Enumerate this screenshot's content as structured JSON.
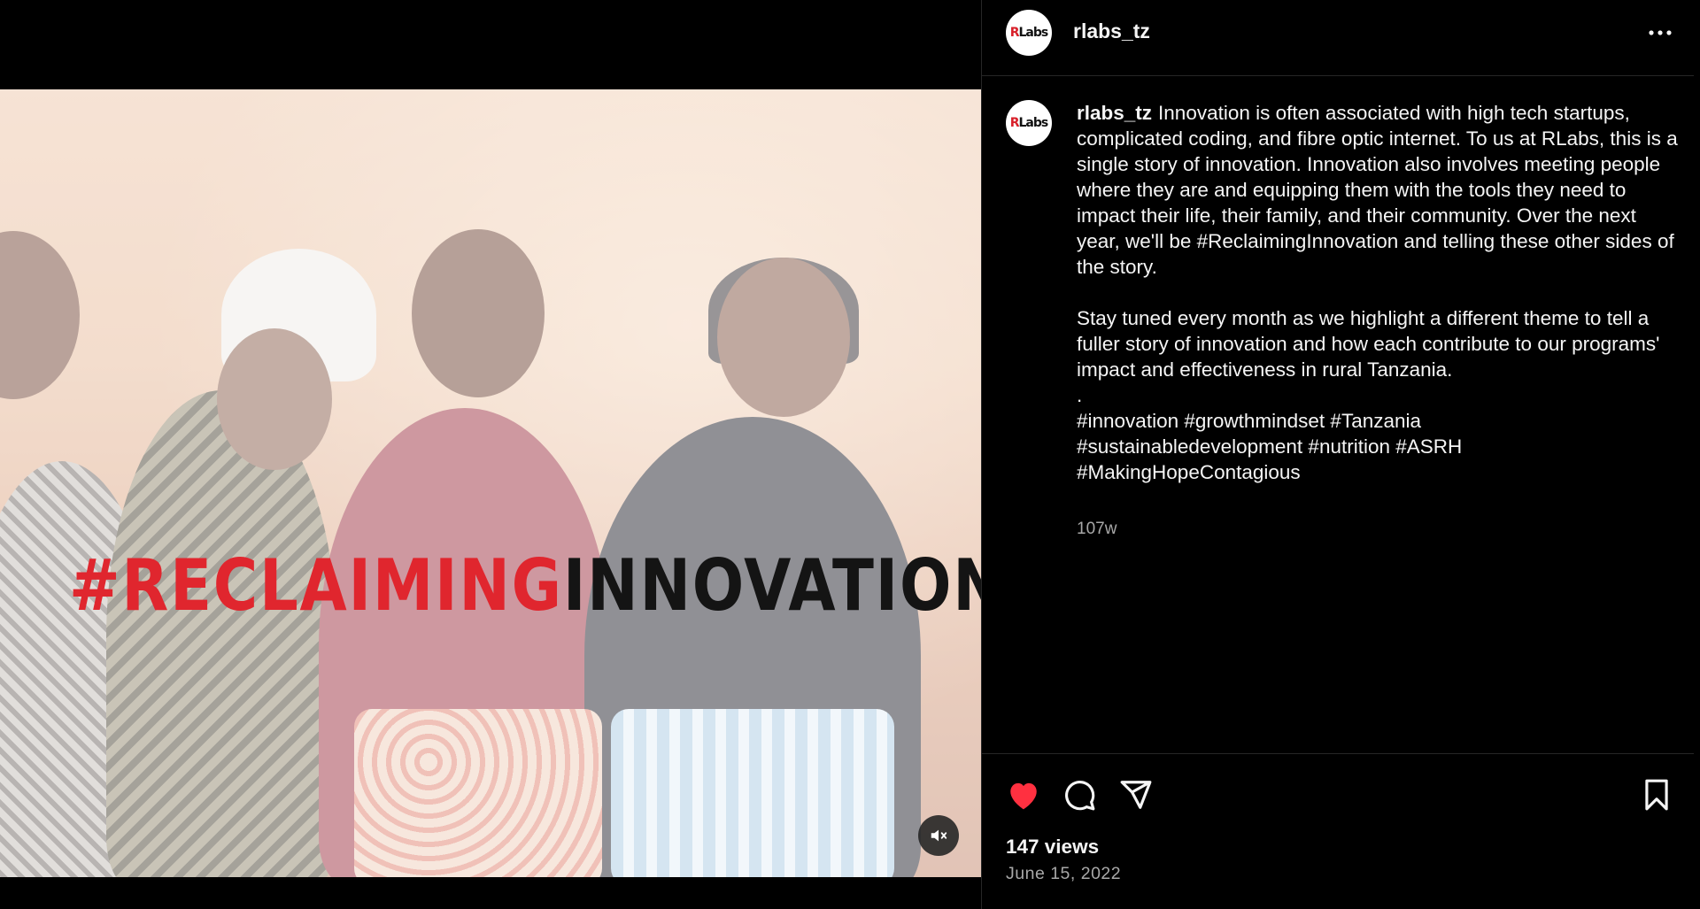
{
  "media": {
    "overlay_text_red": "#RECLAIMING",
    "overlay_text_black": "INNOVATION",
    "mute_icon": "speaker-muted-icon"
  },
  "header": {
    "username": "rlabs_tz",
    "avatar_logo_r": "R",
    "avatar_logo_rest": "Labs",
    "more_icon": "more-horizontal-icon"
  },
  "caption": {
    "username": "rlabs_tz",
    "para1": "Innovation is often associated with high tech startups, complicated coding, and fibre optic internet. To us at RLabs, this is a single story of innovation. Innovation also involves meeting people where they are and equipping them with the tools they need to impact their life, their family, and their community. Over the next year, we'll be #ReclaimingInnovation and telling these other sides of the story.",
    "para2": "Stay tuned every month as we highlight a different theme to tell a fuller story of innovation and how each contribute to our programs' impact and effectiveness in rural Tanzania.",
    "dot": ".",
    "hashtags": "#innovation #growthmindset #Tanzania\n#sustainabledevelopment #nutrition #ASRH\n#MakingHopeContagious",
    "relative_time": "107w"
  },
  "actions": {
    "like_icon": "heart-filled-icon",
    "comment_icon": "comment-icon",
    "share_icon": "paper-plane-icon",
    "save_icon": "bookmark-icon",
    "views": "147 views",
    "date": "June 15, 2022"
  },
  "colors": {
    "like": "#ff3040",
    "overlay_red": "#e0262e",
    "secondary_text": "#a8a8a8"
  }
}
